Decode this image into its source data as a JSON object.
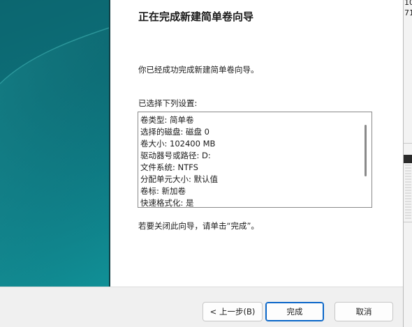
{
  "wizard": {
    "title": "正在完成新建简单卷向导",
    "description": "你已经成功完成新建简单卷向导。",
    "settings_label": "已选择下列设置:",
    "settings": [
      "卷类型: 简单卷",
      "选择的磁盘: 磁盘 0",
      "卷大小: 102400 MB",
      "驱动器号或路径: D:",
      "文件系统: NTFS",
      "分配单元大小: 默认值",
      "卷标: 新加卷",
      "快速格式化: 是"
    ],
    "close_hint": "若要关闭此向导，请单击“完成”。"
  },
  "buttons": {
    "back": "< 上一步(B)",
    "finish": "完成",
    "cancel": "取消"
  },
  "background_window": {
    "text_top": "10",
    "text_second": "71"
  },
  "colors": {
    "banner_dark": "#0b5c66",
    "banner_light": "#129ea4",
    "default_button_border": "#0a66c8"
  }
}
